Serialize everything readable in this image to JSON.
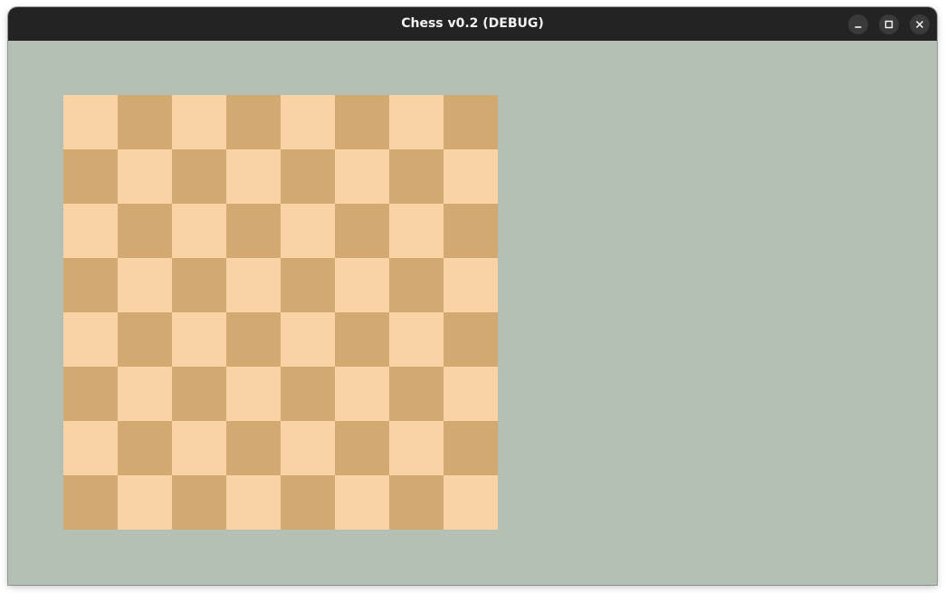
{
  "window": {
    "title": "Chess v0.2 (DEBUG)",
    "controls": [
      "minimize-icon",
      "maximize-icon",
      "close-icon"
    ]
  },
  "colors": {
    "titlebar": "#232323",
    "background": "#b5c0b5",
    "light_square": "#f9d3a5",
    "dark_square": "#d3a972"
  },
  "board": {
    "rows": 8,
    "cols": 8,
    "top_left_square": "light"
  }
}
